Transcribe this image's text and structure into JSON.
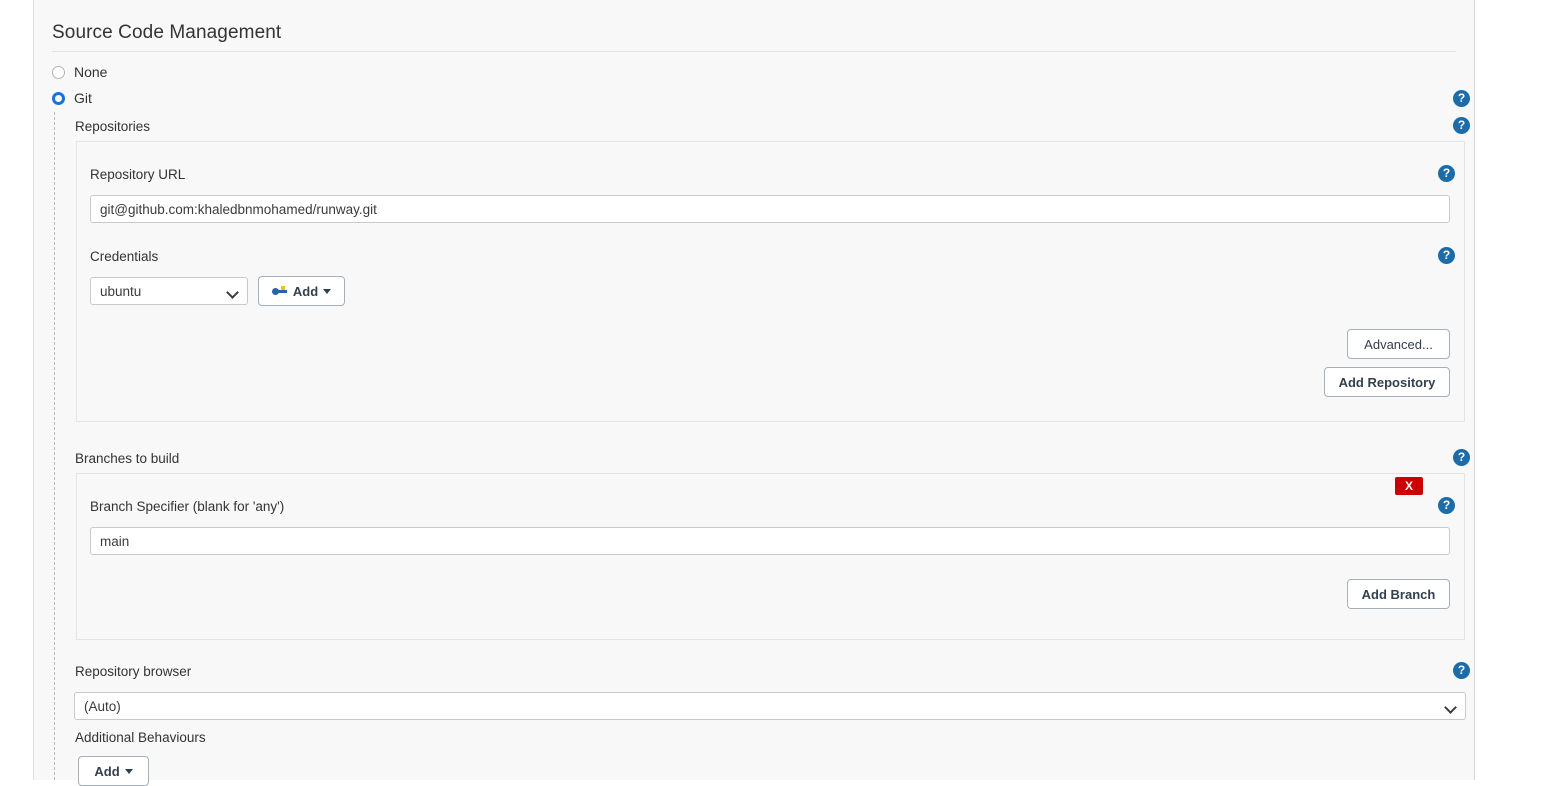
{
  "section": {
    "title": "Source Code Management"
  },
  "scm_options": [
    {
      "label": "None",
      "selected": false
    },
    {
      "label": "Git",
      "selected": true
    }
  ],
  "git": {
    "repositories": {
      "label": "Repositories",
      "repository_url": {
        "label": "Repository URL",
        "value": "git@github.com:khaledbnmohamed/runway.git"
      },
      "credentials": {
        "label": "Credentials",
        "selected": "ubuntu",
        "add_button": "Add",
        "add_icon": "key-icon",
        "caret_icon": "caret-down-icon"
      },
      "advanced_button": "Advanced...",
      "add_repository_button": "Add Repository"
    },
    "branches": {
      "label": "Branches to build",
      "delete_badge": "X",
      "branch_specifier": {
        "label": "Branch Specifier (blank for 'any')",
        "value": "main"
      },
      "add_branch_button": "Add Branch"
    },
    "repository_browser": {
      "label": "Repository browser",
      "selected": "(Auto)"
    },
    "additional_behaviours": {
      "label": "Additional Behaviours",
      "add_button": "Add",
      "caret_icon": "caret-down-icon"
    }
  },
  "help_icons": {
    "glyph": "?",
    "items": [
      "git-help",
      "repositories-help",
      "repository-url-help",
      "credentials-help",
      "branches-to-build-help",
      "branch-specifier-help",
      "repository-browser-help"
    ]
  },
  "colors": {
    "accent_blue": "#1a73d4",
    "help_blue": "#1b6ca8",
    "delete_red": "#cc0000",
    "key_blue": "#2d63a8",
    "key_yellow": "#f2c017",
    "panel_bg": "#f8f8f8"
  }
}
